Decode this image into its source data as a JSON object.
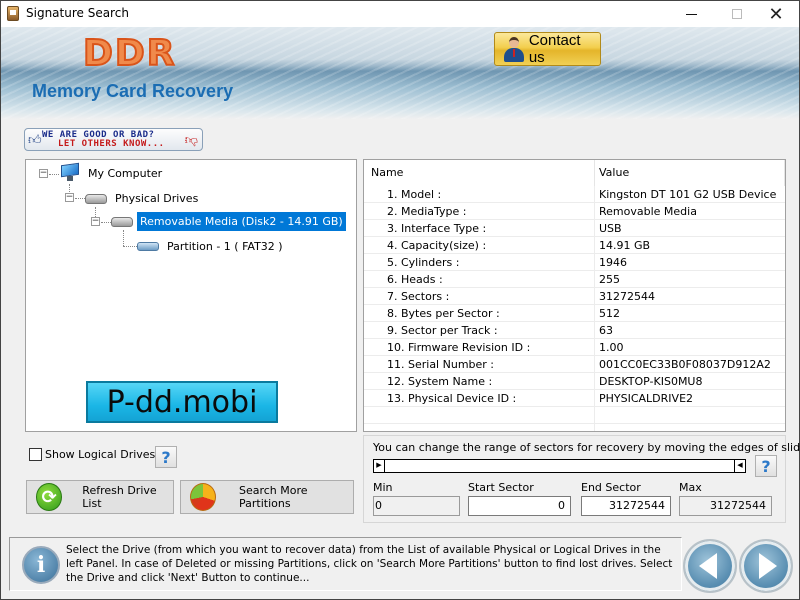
{
  "window": {
    "title": "Signature Search",
    "controls": {
      "minimize": "minimize",
      "maximize": "maximize",
      "close": "close"
    }
  },
  "banner": {
    "logo": "DDR",
    "product": "Memory Card Recovery",
    "contact_label": "Contact us"
  },
  "feedback": {
    "line1": "WE ARE GOOD OR BAD?",
    "line2": "LET OTHERS KNOW..."
  },
  "tree": {
    "nodes": [
      {
        "label": "My Computer",
        "icon": "computer-icon",
        "expanded": true
      },
      {
        "label": "Physical Drives",
        "icon": "drive-icon",
        "expanded": true
      },
      {
        "label": "Removable Media (Disk2 - 14.91 GB)",
        "icon": "drive-icon",
        "expanded": true,
        "selected": true
      },
      {
        "label": "Partition - 1 ( FAT32 )",
        "icon": "partition-icon"
      }
    ]
  },
  "watermark": "P-dd.mobi",
  "details": {
    "columns": [
      "Name",
      "Value"
    ],
    "rows": [
      {
        "name": "1. Model :",
        "value": "Kingston DT 101 G2 USB Device"
      },
      {
        "name": "2. MediaType :",
        "value": "Removable Media"
      },
      {
        "name": "3. Interface Type :",
        "value": "USB"
      },
      {
        "name": "4. Capacity(size) :",
        "value": "14.91 GB"
      },
      {
        "name": "5. Cylinders :",
        "value": "1946"
      },
      {
        "name": "6. Heads :",
        "value": "255"
      },
      {
        "name": "7. Sectors :",
        "value": "31272544"
      },
      {
        "name": "8. Bytes per Sector :",
        "value": "512"
      },
      {
        "name": "9. Sector per Track :",
        "value": "63"
      },
      {
        "name": "10. Firmware Revision ID :",
        "value": "1.00"
      },
      {
        "name": "11. Serial Number :",
        "value": "001CC0EC33B0F08037D912A2"
      },
      {
        "name": "12. System Name :",
        "value": "DESKTOP-KIS0MU8"
      },
      {
        "name": "13. Physical Device ID :",
        "value": "PHYSICALDRIVE2"
      },
      {
        "name": "",
        "value": ""
      },
      {
        "name": "",
        "value": ""
      }
    ]
  },
  "controls": {
    "show_logical_label": "Show Logical Drives",
    "show_logical_checked": false,
    "help_glyph": "?",
    "refresh_label": "Refresh Drive List",
    "search_label": "Search More Partitions"
  },
  "range": {
    "hint": "You can change the range of sectors for recovery by moving the edges of slider:",
    "min_label": "Min",
    "start_label": "Start Sector",
    "end_label": "End Sector",
    "max_label": "Max",
    "min_value": "0",
    "start_value": "0",
    "end_value": "31272544",
    "max_value": "31272544",
    "slider_start_fraction": 0,
    "slider_end_fraction": 1
  },
  "info": {
    "text": "Select the Drive (from which you want to recover data) from the List of available Physical or Logical Drives in the left Panel. In case of Deleted or missing Partitions, click on 'Search More Partitions' button to find lost drives. Select the Drive and click 'Next' Button to continue..."
  },
  "nav": {
    "back": "back",
    "next": "next"
  },
  "colors": {
    "selection": "#0078d7",
    "product_text": "#1b6db3",
    "logo": "#f08a4b",
    "contact_button": "#f3cf4e"
  }
}
